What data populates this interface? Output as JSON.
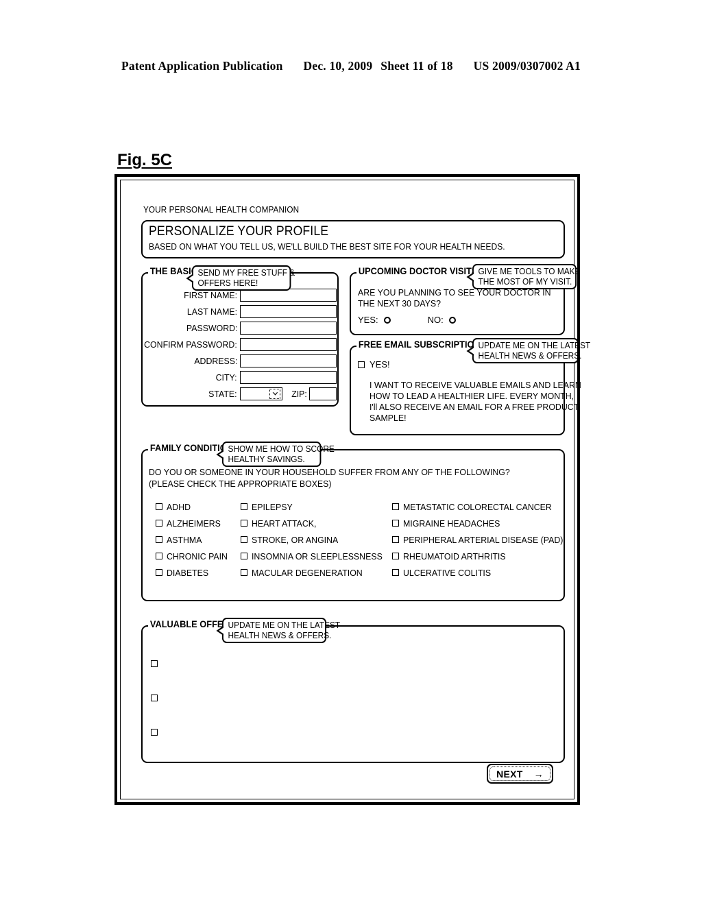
{
  "patent_header": {
    "publication": "Patent Application Publication",
    "date": "Dec. 10, 2009",
    "sheet": "Sheet 11 of 18",
    "number": "US 2009/0307002 A1"
  },
  "figure": {
    "label": "Fig. 5C"
  },
  "screen": {
    "tiny_title": "YOUR PERSONAL HEALTH COMPANION",
    "banner": {
      "heading": "PERSONALIZE YOUR PROFILE",
      "subheading": "BASED ON WHAT YOU TELL US, WE'LL BUILD THE BEST SITE FOR YOUR HEALTH NEEDS."
    },
    "basics": {
      "legend": "THE BASICS",
      "help_icon": "?",
      "callout_line1": "SEND MY FREE STUFF &",
      "callout_line2": "OFFERS HERE!",
      "fields": [
        {
          "label": "FIRST NAME:",
          "value": "",
          "placeholder": ""
        },
        {
          "label": "LAST NAME:",
          "value": "",
          "placeholder": ""
        },
        {
          "label": "PASSWORD:",
          "value": "",
          "placeholder": ""
        },
        {
          "label": "CONFIRM PASSWORD:",
          "value": "",
          "placeholder": ""
        },
        {
          "label": "ADDRESS:",
          "value": "",
          "placeholder": ""
        },
        {
          "label": "CITY:",
          "value": "",
          "placeholder": ""
        }
      ],
      "state_label": "STATE:",
      "state_value": "",
      "state_chevron": "chevron-down-icon",
      "zip_label": "ZIP:",
      "zip_value": ""
    },
    "doctor_visits": {
      "legend": "UPCOMING DOCTOR VISITS",
      "help_icon": "?",
      "callout_line1": "GIVE ME TOOLS TO MAKE",
      "callout_line2": "THE MOST OF MY VISIT.",
      "question_line1": "ARE YOU PLANNING TO SEE YOUR DOCTOR IN",
      "question_line2": "THE NEXT 30 DAYS?",
      "yes_label": "YES:",
      "no_label": "NO:"
    },
    "email_subscription": {
      "legend": "FREE EMAIL SUBSCRIPTION",
      "help_icon": "?",
      "callout_line1": "UPDATE ME ON THE LATEST",
      "callout_line2": "HEALTH NEWS & OFFERS.",
      "yes_label": "YES!",
      "body_line1": "I WANT TO RECEIVE VALUABLE EMAILS AND LEARN",
      "body_line2": "HOW TO LEAD A HEALTHIER LIFE. EVERY MONTH,",
      "body_line3": "I'll ALSO RECEIVE AN EMAIL FOR A FREE PRODUCT",
      "body_line4": "SAMPLE!"
    },
    "family_conditions": {
      "legend": "FAMILY CONDITIONS",
      "help_icon": "?",
      "callout_line1": "SHOW ME HOW TO SCORE",
      "callout_line2": "HEALTHY SAVINGS.",
      "question_line1": "DO YOU OR SOMEONE IN YOUR HOUSEHOLD SUFFER FROM ANY OF THE FOLLOWING?",
      "question_line2": "(PLEASE CHECK THE APPROPRIATE BOXES)",
      "column1": [
        "ADHD",
        "ALZHEIMERS",
        "ASTHMA",
        "CHRONIC PAIN",
        "DIABETES"
      ],
      "column2": [
        "EPILEPSY",
        "HEART ATTACK,",
        "STROKE, OR ANGINA",
        "INSOMNIA OR SLEEPLESSNESS",
        "MACULAR DEGENERATION"
      ],
      "column3": [
        "METASTATIC COLORECTAL CANCER",
        "MIGRAINE HEADACHES",
        "PERIPHERAL ARTERIAL DISEASE (PAD)",
        "RHEUMATOID ARTHRITIS",
        "ULCERATIVE COLITIS"
      ]
    },
    "valuable_offers": {
      "legend": "VALUABLE OFFERS",
      "help_icon": "?",
      "callout_line1": "UPDATE ME ON THE LATEST",
      "callout_line2": "HEALTH NEWS & OFFERS.",
      "items": [
        "",
        "",
        ""
      ]
    },
    "next_button": {
      "label": "NEXT",
      "arrow": "→"
    }
  }
}
